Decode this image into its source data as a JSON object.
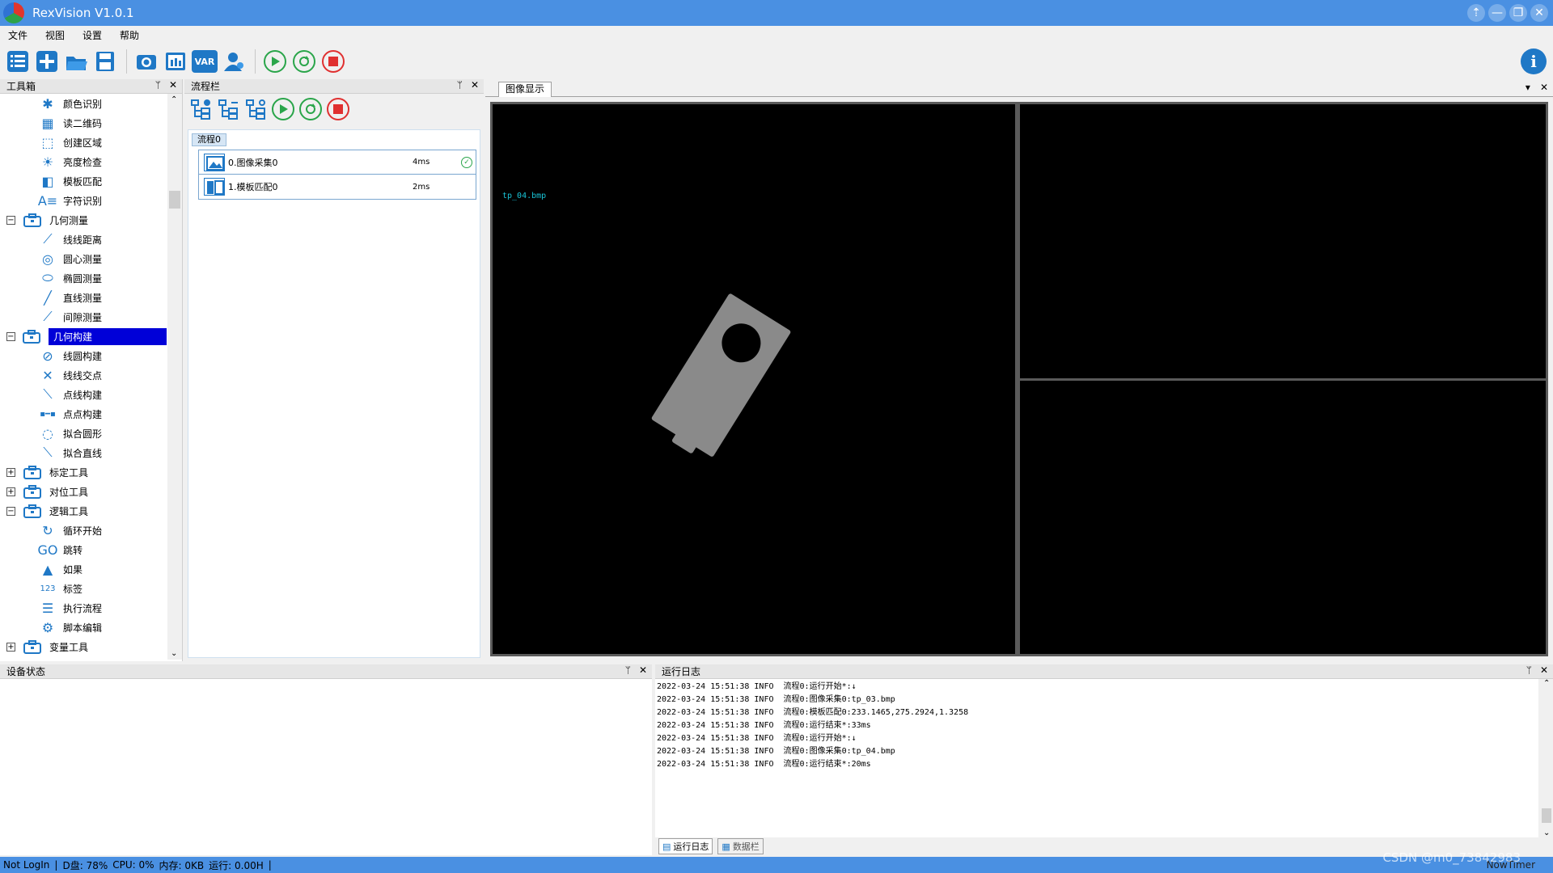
{
  "app": {
    "title": "RexVision V1.0.1"
  },
  "window_controls": [
    "⇡",
    "—",
    "❐",
    "✕"
  ],
  "menu": [
    "文件",
    "视图",
    "设置",
    "帮助"
  ],
  "toolbar": {
    "var_label": "VAR",
    "info_label": "i"
  },
  "toolbox": {
    "title": "工具箱",
    "items": [
      {
        "type": "child",
        "label": "颜色识别",
        "icon": "snowflake-icon",
        "glyph": "✱"
      },
      {
        "type": "child",
        "label": "读二维码",
        "icon": "qrcode-icon",
        "glyph": "▦"
      },
      {
        "type": "child",
        "label": "创建区域",
        "icon": "region-icon",
        "glyph": "⬚"
      },
      {
        "type": "child",
        "label": "亮度检查",
        "icon": "brightness-icon",
        "glyph": "☀"
      },
      {
        "type": "child",
        "label": "模板匹配",
        "icon": "template-icon",
        "glyph": "◧"
      },
      {
        "type": "child",
        "label": "字符识别",
        "icon": "ocr-icon",
        "glyph": "A≡"
      },
      {
        "type": "group",
        "label": "几何测量",
        "expander": "−",
        "icon": "toolbox-icon"
      },
      {
        "type": "child",
        "label": "线线距离",
        "icon": "line-distance-icon",
        "glyph": "⟋"
      },
      {
        "type": "child",
        "label": "圆心测量",
        "icon": "circle-measure-icon",
        "glyph": "◎"
      },
      {
        "type": "child",
        "label": "椭圆测量",
        "icon": "ellipse-icon",
        "glyph": "⬭"
      },
      {
        "type": "child",
        "label": "直线测量",
        "icon": "line-measure-icon",
        "glyph": "╱"
      },
      {
        "type": "child",
        "label": "间隙测量",
        "icon": "gap-measure-icon",
        "glyph": "⟋"
      },
      {
        "type": "group",
        "label": "几何构建",
        "expander": "−",
        "icon": "toolbox-icon",
        "selected": true
      },
      {
        "type": "child",
        "label": "线圆构建",
        "icon": "line-circle-icon",
        "glyph": "⊘"
      },
      {
        "type": "child",
        "label": "线线交点",
        "icon": "intersection-icon",
        "glyph": "✕"
      },
      {
        "type": "child",
        "label": "点线构建",
        "icon": "point-line-icon",
        "glyph": "⟍"
      },
      {
        "type": "child",
        "label": "点点构建",
        "icon": "point-point-icon",
        "glyph": "▪━▪"
      },
      {
        "type": "child",
        "label": "拟合圆形",
        "icon": "fit-circle-icon",
        "glyph": "◌"
      },
      {
        "type": "child",
        "label": "拟合直线",
        "icon": "fit-line-icon",
        "glyph": "⟍"
      },
      {
        "type": "group",
        "label": "标定工具",
        "expander": "+",
        "icon": "toolbox-icon"
      },
      {
        "type": "group",
        "label": "对位工具",
        "expander": "+",
        "icon": "toolbox-icon"
      },
      {
        "type": "group",
        "label": "逻辑工具",
        "expander": "−",
        "icon": "toolbox-icon"
      },
      {
        "type": "child",
        "label": "循环开始",
        "icon": "loop-icon",
        "glyph": "↻"
      },
      {
        "type": "child",
        "label": "跳转",
        "icon": "goto-icon",
        "glyph": "GO"
      },
      {
        "type": "child",
        "label": "如果",
        "icon": "if-icon",
        "glyph": "▲"
      },
      {
        "type": "child",
        "label": "标签",
        "icon": "label-icon",
        "glyph": "123"
      },
      {
        "type": "child",
        "label": "执行流程",
        "icon": "execute-flow-icon",
        "glyph": "☰"
      },
      {
        "type": "child",
        "label": "脚本编辑",
        "icon": "script-icon",
        "glyph": "⚙"
      },
      {
        "type": "group",
        "label": "变量工具",
        "expander": "+",
        "icon": "toolbox-icon"
      }
    ]
  },
  "flowbar": {
    "title": "流程栏",
    "tab": "流程0",
    "rows": [
      {
        "name": "0.图像采集0",
        "time": "4ms",
        "ok": true
      },
      {
        "name": "1.模板匹配0",
        "time": "2ms",
        "ok": false
      }
    ]
  },
  "image_display": {
    "title": "图像显示",
    "overlay_filename": "tp_04.bmp"
  },
  "device_status": {
    "title": "设备状态"
  },
  "run_log": {
    "title": "运行日志",
    "lines": [
      "2022-03-24 15:51:38 INFO  流程0:运行开始*:↓",
      "2022-03-24 15:51:38 INFO  流程0:图像采集0:tp_03.bmp",
      "2022-03-24 15:51:38 INFO  流程0:模板匹配0:233.1465,275.2924,1.3258",
      "2022-03-24 15:51:38 INFO  流程0:运行结束*:33ms",
      "2022-03-24 15:51:38 INFO  流程0:运行开始*:↓",
      "2022-03-24 15:51:38 INFO  流程0:图像采集0:tp_04.bmp",
      "2022-03-24 15:51:38 INFO  流程0:运行结束*:20ms"
    ],
    "tabs": [
      "运行日志",
      "数据栏"
    ]
  },
  "status": {
    "login": "Not LogIn",
    "disk": "D盘: 78%",
    "cpu": "CPU: 0%",
    "memory": "内存: 0KB",
    "runtime": "运行: 0.00H",
    "right": "NowTimer"
  },
  "watermark": "CSDN @m0_73842983",
  "colors": {
    "accent": "#4a90e2",
    "icon_blue": "#1f78c6",
    "selection": "#0000d8",
    "overlay_text": "#19c3d6"
  }
}
